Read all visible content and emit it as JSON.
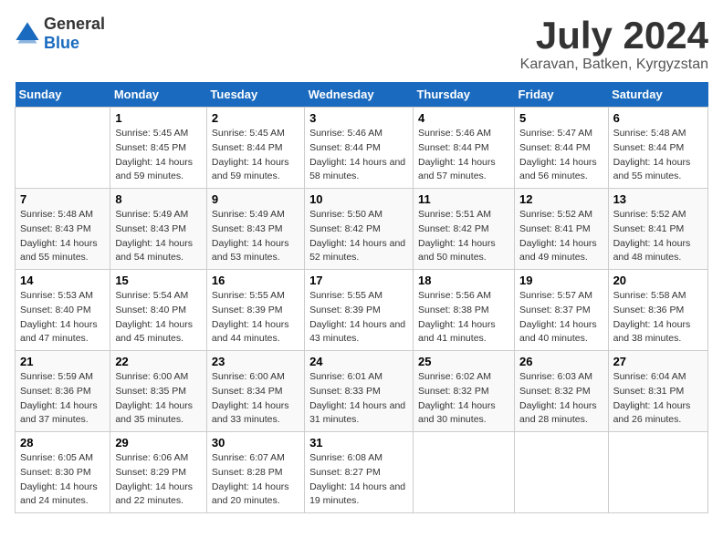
{
  "header": {
    "logo_general": "General",
    "logo_blue": "Blue",
    "month_year": "July 2024",
    "location": "Karavan, Batken, Kyrgyzstan"
  },
  "days_of_week": [
    "Sunday",
    "Monday",
    "Tuesday",
    "Wednesday",
    "Thursday",
    "Friday",
    "Saturday"
  ],
  "weeks": [
    [
      {
        "day": "",
        "sunrise": "",
        "sunset": "",
        "daylight": ""
      },
      {
        "day": "1",
        "sunrise": "Sunrise: 5:45 AM",
        "sunset": "Sunset: 8:45 PM",
        "daylight": "Daylight: 14 hours and 59 minutes."
      },
      {
        "day": "2",
        "sunrise": "Sunrise: 5:45 AM",
        "sunset": "Sunset: 8:44 PM",
        "daylight": "Daylight: 14 hours and 59 minutes."
      },
      {
        "day": "3",
        "sunrise": "Sunrise: 5:46 AM",
        "sunset": "Sunset: 8:44 PM",
        "daylight": "Daylight: 14 hours and 58 minutes."
      },
      {
        "day": "4",
        "sunrise": "Sunrise: 5:46 AM",
        "sunset": "Sunset: 8:44 PM",
        "daylight": "Daylight: 14 hours and 57 minutes."
      },
      {
        "day": "5",
        "sunrise": "Sunrise: 5:47 AM",
        "sunset": "Sunset: 8:44 PM",
        "daylight": "Daylight: 14 hours and 56 minutes."
      },
      {
        "day": "6",
        "sunrise": "Sunrise: 5:48 AM",
        "sunset": "Sunset: 8:44 PM",
        "daylight": "Daylight: 14 hours and 55 minutes."
      }
    ],
    [
      {
        "day": "7",
        "sunrise": "Sunrise: 5:48 AM",
        "sunset": "Sunset: 8:43 PM",
        "daylight": "Daylight: 14 hours and 55 minutes."
      },
      {
        "day": "8",
        "sunrise": "Sunrise: 5:49 AM",
        "sunset": "Sunset: 8:43 PM",
        "daylight": "Daylight: 14 hours and 54 minutes."
      },
      {
        "day": "9",
        "sunrise": "Sunrise: 5:49 AM",
        "sunset": "Sunset: 8:43 PM",
        "daylight": "Daylight: 14 hours and 53 minutes."
      },
      {
        "day": "10",
        "sunrise": "Sunrise: 5:50 AM",
        "sunset": "Sunset: 8:42 PM",
        "daylight": "Daylight: 14 hours and 52 minutes."
      },
      {
        "day": "11",
        "sunrise": "Sunrise: 5:51 AM",
        "sunset": "Sunset: 8:42 PM",
        "daylight": "Daylight: 14 hours and 50 minutes."
      },
      {
        "day": "12",
        "sunrise": "Sunrise: 5:52 AM",
        "sunset": "Sunset: 8:41 PM",
        "daylight": "Daylight: 14 hours and 49 minutes."
      },
      {
        "day": "13",
        "sunrise": "Sunrise: 5:52 AM",
        "sunset": "Sunset: 8:41 PM",
        "daylight": "Daylight: 14 hours and 48 minutes."
      }
    ],
    [
      {
        "day": "14",
        "sunrise": "Sunrise: 5:53 AM",
        "sunset": "Sunset: 8:40 PM",
        "daylight": "Daylight: 14 hours and 47 minutes."
      },
      {
        "day": "15",
        "sunrise": "Sunrise: 5:54 AM",
        "sunset": "Sunset: 8:40 PM",
        "daylight": "Daylight: 14 hours and 45 minutes."
      },
      {
        "day": "16",
        "sunrise": "Sunrise: 5:55 AM",
        "sunset": "Sunset: 8:39 PM",
        "daylight": "Daylight: 14 hours and 44 minutes."
      },
      {
        "day": "17",
        "sunrise": "Sunrise: 5:55 AM",
        "sunset": "Sunset: 8:39 PM",
        "daylight": "Daylight: 14 hours and 43 minutes."
      },
      {
        "day": "18",
        "sunrise": "Sunrise: 5:56 AM",
        "sunset": "Sunset: 8:38 PM",
        "daylight": "Daylight: 14 hours and 41 minutes."
      },
      {
        "day": "19",
        "sunrise": "Sunrise: 5:57 AM",
        "sunset": "Sunset: 8:37 PM",
        "daylight": "Daylight: 14 hours and 40 minutes."
      },
      {
        "day": "20",
        "sunrise": "Sunrise: 5:58 AM",
        "sunset": "Sunset: 8:36 PM",
        "daylight": "Daylight: 14 hours and 38 minutes."
      }
    ],
    [
      {
        "day": "21",
        "sunrise": "Sunrise: 5:59 AM",
        "sunset": "Sunset: 8:36 PM",
        "daylight": "Daylight: 14 hours and 37 minutes."
      },
      {
        "day": "22",
        "sunrise": "Sunrise: 6:00 AM",
        "sunset": "Sunset: 8:35 PM",
        "daylight": "Daylight: 14 hours and 35 minutes."
      },
      {
        "day": "23",
        "sunrise": "Sunrise: 6:00 AM",
        "sunset": "Sunset: 8:34 PM",
        "daylight": "Daylight: 14 hours and 33 minutes."
      },
      {
        "day": "24",
        "sunrise": "Sunrise: 6:01 AM",
        "sunset": "Sunset: 8:33 PM",
        "daylight": "Daylight: 14 hours and 31 minutes."
      },
      {
        "day": "25",
        "sunrise": "Sunrise: 6:02 AM",
        "sunset": "Sunset: 8:32 PM",
        "daylight": "Daylight: 14 hours and 30 minutes."
      },
      {
        "day": "26",
        "sunrise": "Sunrise: 6:03 AM",
        "sunset": "Sunset: 8:32 PM",
        "daylight": "Daylight: 14 hours and 28 minutes."
      },
      {
        "day": "27",
        "sunrise": "Sunrise: 6:04 AM",
        "sunset": "Sunset: 8:31 PM",
        "daylight": "Daylight: 14 hours and 26 minutes."
      }
    ],
    [
      {
        "day": "28",
        "sunrise": "Sunrise: 6:05 AM",
        "sunset": "Sunset: 8:30 PM",
        "daylight": "Daylight: 14 hours and 24 minutes."
      },
      {
        "day": "29",
        "sunrise": "Sunrise: 6:06 AM",
        "sunset": "Sunset: 8:29 PM",
        "daylight": "Daylight: 14 hours and 22 minutes."
      },
      {
        "day": "30",
        "sunrise": "Sunrise: 6:07 AM",
        "sunset": "Sunset: 8:28 PM",
        "daylight": "Daylight: 14 hours and 20 minutes."
      },
      {
        "day": "31",
        "sunrise": "Sunrise: 6:08 AM",
        "sunset": "Sunset: 8:27 PM",
        "daylight": "Daylight: 14 hours and 19 minutes."
      },
      {
        "day": "",
        "sunrise": "",
        "sunset": "",
        "daylight": ""
      },
      {
        "day": "",
        "sunrise": "",
        "sunset": "",
        "daylight": ""
      },
      {
        "day": "",
        "sunrise": "",
        "sunset": "",
        "daylight": ""
      }
    ]
  ]
}
